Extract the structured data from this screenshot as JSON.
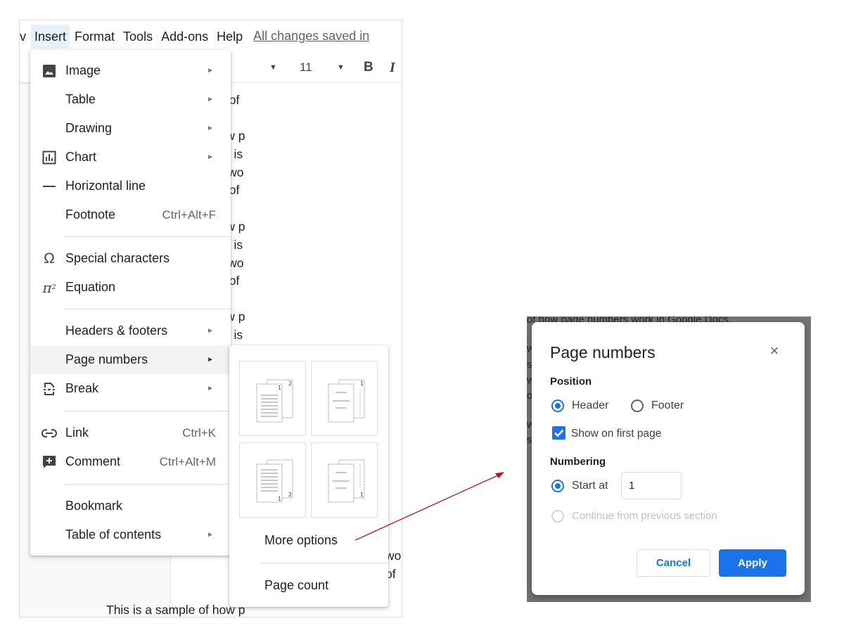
{
  "menubar": {
    "partial_left": "v",
    "items": [
      "Insert",
      "Format",
      "Tools",
      "Add-ons",
      "Help"
    ],
    "saved_status": "All changes saved in"
  },
  "toolbar": {
    "font_size": "11",
    "bold": "B",
    "italic": "I"
  },
  "document": {
    "lines": [
      "click. This is a sample of",
      "This is a sample of how p",
      "with a tap or click. This is",
      "of how page numbers wo",
      "click. This is a sample of",
      "This is a sample of how p",
      "with a tap or click. This is",
      "of how page numbers wo",
      "click. This is a sample of",
      "This is a sample of how p",
      "with a tap or click. This is",
      "wo",
      "of",
      "This is a sample of how p"
    ]
  },
  "insert_menu": {
    "items": [
      {
        "label": "Image",
        "icon": "image-icon",
        "has_submenu": true
      },
      {
        "label": "Table",
        "has_submenu": true
      },
      {
        "label": "Drawing",
        "has_submenu": true
      },
      {
        "label": "Chart",
        "icon": "chart-icon",
        "has_submenu": true
      },
      {
        "label": "Horizontal line",
        "icon": "horizontal-line-icon"
      },
      {
        "label": "Footnote",
        "shortcut": "Ctrl+Alt+F"
      },
      {
        "label": "Special characters",
        "icon": "omega-icon"
      },
      {
        "label": "Equation",
        "icon": "pi-icon"
      },
      {
        "label": "Headers & footers",
        "has_submenu": true
      },
      {
        "label": "Page numbers",
        "has_submenu": true
      },
      {
        "label": "Break",
        "icon": "break-icon",
        "has_submenu": true
      },
      {
        "label": "Link",
        "icon": "link-icon",
        "shortcut": "Ctrl+K"
      },
      {
        "label": "Comment",
        "icon": "comment-icon",
        "shortcut": "Ctrl+Alt+M"
      },
      {
        "label": "Bookmark"
      },
      {
        "label": "Table of contents",
        "has_submenu": true
      }
    ],
    "submenu_arrow": "►"
  },
  "page_numbers_submenu": {
    "more_options": "More options",
    "page_count": "Page count"
  },
  "dialog": {
    "background_text": [
      "of how page numbers work in Google Docs.",
      "w",
      "s",
      "w",
      "o",
      "w",
      "s"
    ],
    "title": "Page numbers",
    "close": "×",
    "position_label": "Position",
    "header_label": "Header",
    "footer_label": "Footer",
    "show_first_page_label": "Show on first page",
    "numbering_label": "Numbering",
    "start_at_label": "Start at",
    "start_at_value": "1",
    "continue_label": "Continue from previous section",
    "cancel_label": "Cancel",
    "apply_label": "Apply",
    "position_selected": "Header",
    "show_on_first_page": true,
    "numbering_selected": "Start at"
  },
  "colors": {
    "accent": "#1a73e8",
    "arrow": "#c0161e",
    "menu_highlight": "#f1f3f4"
  }
}
